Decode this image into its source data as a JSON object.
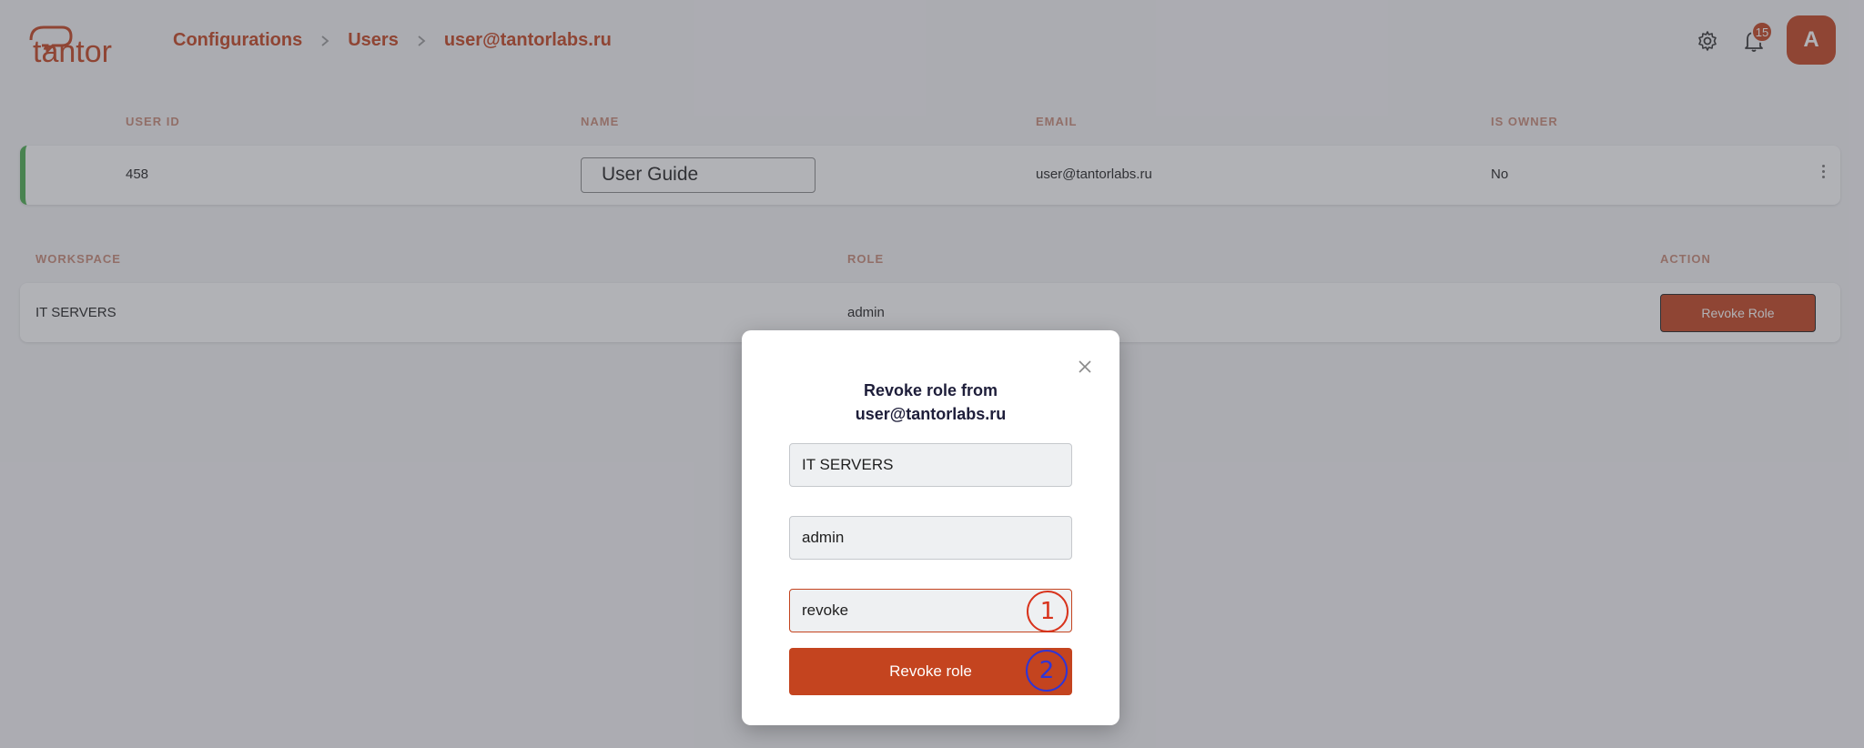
{
  "header": {
    "logo_text": "tantor",
    "breadcrumb": [
      "Configurations",
      "Users",
      "user@tantorlabs.ru"
    ],
    "notification_count": "15",
    "avatar_letter": "A"
  },
  "user_table": {
    "headers": [
      "USER ID",
      "NAME",
      "EMAIL",
      "IS OWNER"
    ],
    "row": {
      "user_id": "458",
      "name": "User Guide",
      "email": "user@tantorlabs.ru",
      "is_owner": "No"
    }
  },
  "roles_table": {
    "headers": [
      "WORKSPACE",
      "ROLE",
      "ACTION"
    ],
    "row": {
      "workspace": "IT SERVERS",
      "role": "admin",
      "action_label": "Revoke Role"
    }
  },
  "modal": {
    "title_line1": "Revoke role from",
    "title_line2": "user@tantorlabs.ru",
    "workspace_value": "IT SERVERS",
    "role_value": "admin",
    "confirm_value": "revoke",
    "confirm_button": "Revoke role",
    "step1": "1",
    "step2": "2"
  },
  "colors": {
    "accent": "#c4441f",
    "owner_indicator": "#4caf50",
    "marker1": "#d8331c",
    "marker2": "#2f35d6"
  }
}
